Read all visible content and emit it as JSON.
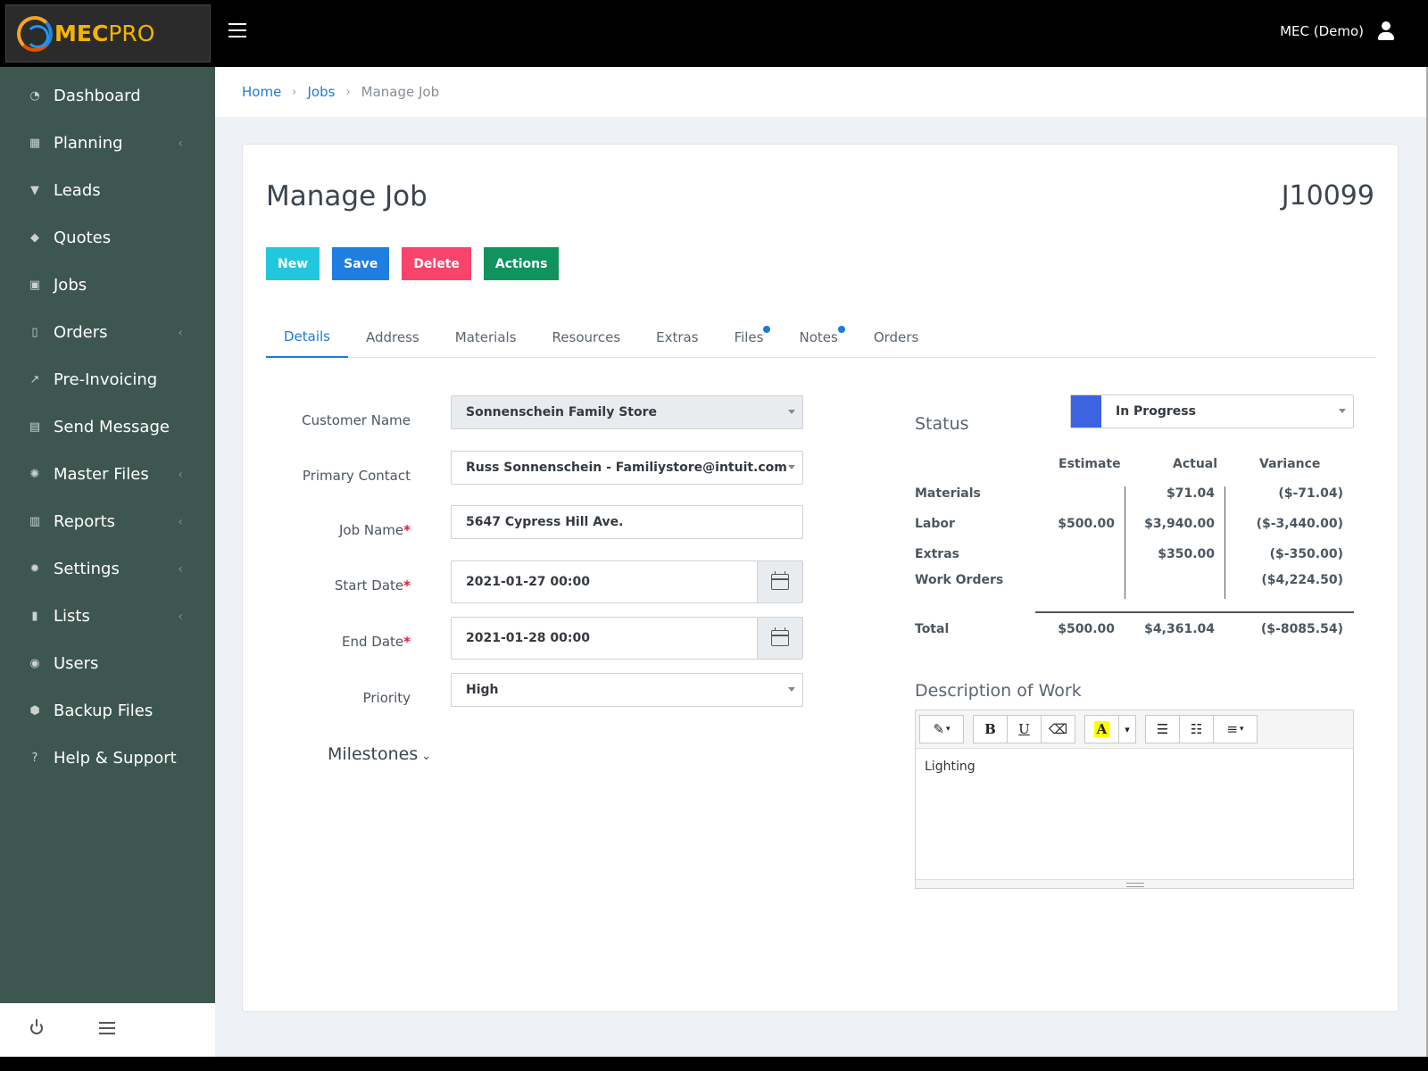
{
  "app": {
    "brand_left": "MEC",
    "brand_right": "PRO",
    "user_name": "MEC (Demo)"
  },
  "sidebar": {
    "items": [
      {
        "label": "Dashboard",
        "icon": "dashboard-icon",
        "glyph": "◔",
        "has_caret": false
      },
      {
        "label": "Planning",
        "icon": "calendar-icon",
        "glyph": "▦",
        "has_caret": true
      },
      {
        "label": "Leads",
        "icon": "filter-icon",
        "glyph": "▼",
        "has_caret": false
      },
      {
        "label": "Quotes",
        "icon": "tags-icon",
        "glyph": "◆",
        "has_caret": false
      },
      {
        "label": "Jobs",
        "icon": "jobs-icon",
        "glyph": "▣",
        "has_caret": false
      },
      {
        "label": "Orders",
        "icon": "clipboard-icon",
        "glyph": "▯",
        "has_caret": true
      },
      {
        "label": "Pre-Invoicing",
        "icon": "trend-icon",
        "glyph": "↗",
        "has_caret": false
      },
      {
        "label": "Send Message",
        "icon": "message-icon",
        "glyph": "▤",
        "has_caret": false
      },
      {
        "label": "Master Files",
        "icon": "badge-icon",
        "glyph": "✺",
        "has_caret": true
      },
      {
        "label": "Reports",
        "icon": "file-icon",
        "glyph": "▥",
        "has_caret": true
      },
      {
        "label": "Settings",
        "icon": "gear-icon",
        "glyph": "✹",
        "has_caret": true
      },
      {
        "label": "Lists",
        "icon": "bookmark-icon",
        "glyph": "▮",
        "has_caret": true
      },
      {
        "label": "Users",
        "icon": "user-circle-icon",
        "glyph": "◉",
        "has_caret": false
      },
      {
        "label": "Backup Files",
        "icon": "shield-icon",
        "glyph": "⬢",
        "has_caret": false
      },
      {
        "label": "Help & Support",
        "icon": "question-icon",
        "glyph": "?",
        "has_caret": false
      }
    ],
    "caret": "‹"
  },
  "breadcrumb": {
    "home": "Home",
    "jobs": "Jobs",
    "current": "Manage Job",
    "separator": "›"
  },
  "page": {
    "title": "Manage Job",
    "job_number": "J10099"
  },
  "buttons": {
    "new": "New",
    "save": "Save",
    "delete": "Delete",
    "actions": "Actions"
  },
  "tabs": [
    {
      "label": "Details",
      "active": true,
      "dot": false
    },
    {
      "label": "Address",
      "active": false,
      "dot": false
    },
    {
      "label": "Materials",
      "active": false,
      "dot": false
    },
    {
      "label": "Resources",
      "active": false,
      "dot": false
    },
    {
      "label": "Extras",
      "active": false,
      "dot": false
    },
    {
      "label": "Files",
      "active": false,
      "dot": true
    },
    {
      "label": "Notes",
      "active": false,
      "dot": true
    },
    {
      "label": "Orders",
      "active": false,
      "dot": false
    }
  ],
  "form": {
    "customer_name_label": "Customer Name",
    "customer_name_value": "Sonnenschein Family Store",
    "primary_contact_label": "Primary Contact",
    "primary_contact_value": "Russ Sonnenschein - Familiystore@intuit.com",
    "job_name_label": "Job Name",
    "job_name_value": "5647 Cypress Hill Ave.",
    "start_date_label": "Start Date",
    "start_date_value": "2021-01-27 00:00",
    "end_date_label": "End Date",
    "end_date_value": "2021-01-28 00:00",
    "priority_label": "Priority",
    "priority_value": "High",
    "required_mark": "*",
    "milestones_label": "Milestones",
    "milestones_chevron": "⌄"
  },
  "status": {
    "label": "Status",
    "value": "In Progress",
    "color": "#3d63e0"
  },
  "costs": {
    "headers": {
      "estimate": "Estimate",
      "actual": "Actual",
      "variance": "Variance"
    },
    "rows": [
      {
        "name": "Materials",
        "estimate": "",
        "actual": "$71.04",
        "variance": "($-71.04)"
      },
      {
        "name": "Labor",
        "estimate": "$500.00",
        "actual": "$3,940.00",
        "variance": "($-3,440.00)"
      },
      {
        "name": "Extras",
        "estimate": "",
        "actual": "$350.00",
        "variance": "($-350.00)"
      },
      {
        "name": "Work Orders",
        "estimate": "",
        "actual": "",
        "variance": "($4,224.50)"
      }
    ],
    "total": {
      "name": "Total",
      "estimate": "$500.00",
      "actual": "$4,361.04",
      "variance": "($-8085.54)"
    }
  },
  "description": {
    "label": "Description of Work",
    "content": "Lighting",
    "toolbar": {
      "magic": "✎",
      "bold": "B",
      "underline": "U",
      "eraser": "⌫",
      "color": "A",
      "dropdown": "▾",
      "bullet_list": "☰",
      "numbered_list": "☷",
      "align": "≡"
    }
  },
  "colors": {
    "sidebar_bg": "#3e5650",
    "accent": "#1e7ad9",
    "new_btn": "#22c7dd",
    "save_btn": "#1f7ee0",
    "delete_btn": "#f8446b",
    "actions_btn": "#10935d"
  }
}
